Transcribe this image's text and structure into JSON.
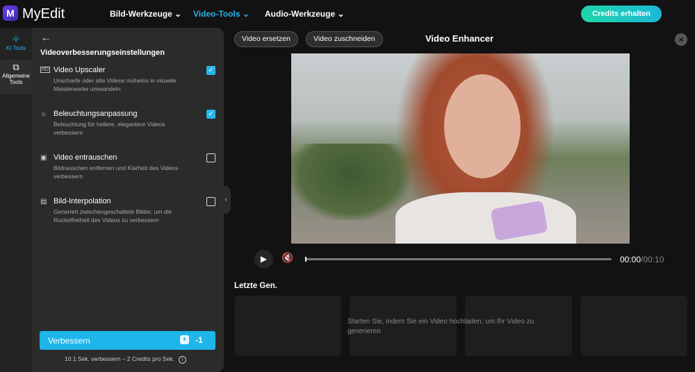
{
  "header": {
    "brand": "MyEdit",
    "logo": "M",
    "nav": [
      "Bild-Werkzeuge",
      "Video-Tools",
      "Audio-Werkzeuge"
    ],
    "credits_button": "Credits erhalten"
  },
  "sidebar": {
    "items": [
      {
        "label": "KI Tools",
        "icon": "magic-wand-icon"
      },
      {
        "label": "Allgemeine Tools",
        "icon": "layers-icon"
      }
    ]
  },
  "settings": {
    "title": "Videoverbesserungseinstellungen",
    "options": [
      {
        "title": "Video Upscaler",
        "desc": "Unscharfe oder alte Videos mühelos in visuelle Meisterwerke umwandeln",
        "checked": true,
        "icon": "HD"
      },
      {
        "title": "Beleuchtungsanpassung",
        "desc": "Beleuchtung für hellere, elegantere Videos verbessern",
        "checked": true,
        "icon": "☼"
      },
      {
        "title": "Video entrauschen",
        "desc": "Bildrauschen entfernen und Klarheit des Videos verbessern",
        "checked": false,
        "icon": "▣"
      },
      {
        "title": "Bild-Interpolation",
        "desc": "Generiert zwischengeschaltete Bilder, um die Ruckelfreiheit des Videos zu verbessern",
        "checked": false,
        "icon": "▤"
      }
    ],
    "enhance_button": "Verbessern",
    "credit_cost": "-1",
    "note": "10.1 Sek. verbessern – 2 Credits pro Sek."
  },
  "main": {
    "replace_button": "Video ersetzen",
    "crop_button": "Video zuschneiden",
    "title": "Video Enhancer",
    "player": {
      "current": "00:00",
      "total": "/00:10",
      "progress": 0
    },
    "recent_title": "Letzte Gen.",
    "empty_text": "Starten Sie, indem Sie ein Video hochladen, um Ihr Video zu generieren"
  },
  "colors": {
    "accent": "#1db5ea",
    "background": "#121212",
    "panel": "#2b2b2b"
  }
}
